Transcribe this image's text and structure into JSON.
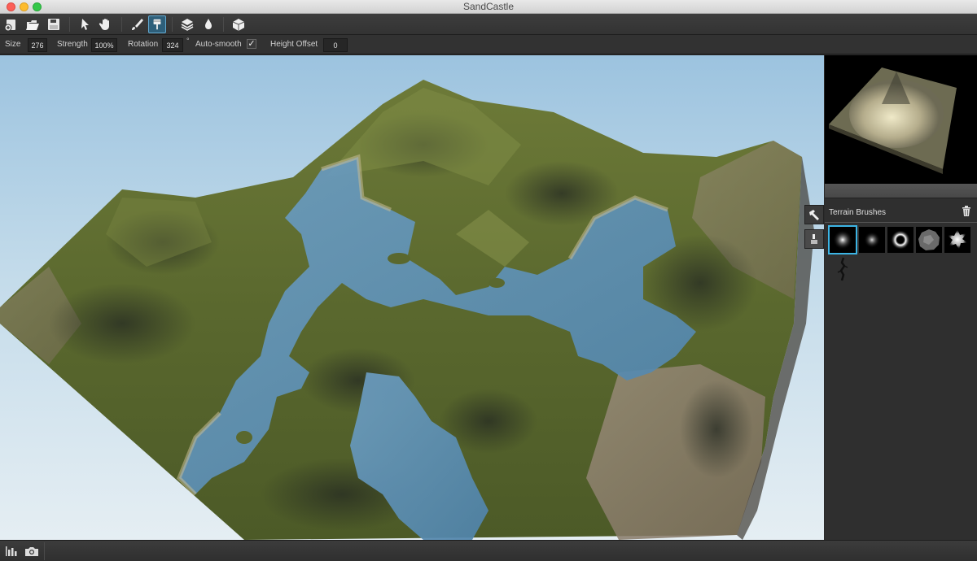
{
  "window": {
    "title": "SandCastle"
  },
  "toolbar": {
    "buttons": [
      {
        "name": "new-scene-icon",
        "tooltip": ""
      },
      {
        "name": "open-icon"
      },
      {
        "name": "save-icon"
      },
      {
        "name": "select-arrow-icon"
      },
      {
        "name": "pan-hand-icon"
      },
      {
        "name": "paintbrush-icon"
      },
      {
        "name": "terrain-brush-icon",
        "active": true
      },
      {
        "name": "layers-icon"
      },
      {
        "name": "water-drop-icon"
      },
      {
        "name": "export-object-icon"
      }
    ]
  },
  "options": {
    "size_label": "Size",
    "size_value": "276",
    "strength_label": "Strength",
    "strength_value": "100%",
    "rotation_label": "Rotation",
    "rotation_value": "324",
    "degree_symbol": "°",
    "autosmooth_label": "Auto-smooth",
    "autosmooth_checked": true,
    "height_offset_label": "Height Offset",
    "height_offset_value": "0"
  },
  "right_panel": {
    "brushes_title": "Terrain Brushes",
    "brushes": [
      {
        "name": "soft-round-brush",
        "selected": true
      },
      {
        "name": "soft-small-brush",
        "selected": false
      },
      {
        "name": "ring-crater-brush",
        "selected": false
      },
      {
        "name": "rough-rock-brush",
        "selected": false
      },
      {
        "name": "splatter-brush",
        "selected": false
      },
      {
        "name": "crack-brush",
        "selected": false
      }
    ],
    "side_tabs": [
      "hammer-tools-icon",
      "brush-pen-icon"
    ]
  },
  "bottom_bar": {
    "buttons": [
      "stats-bars-icon",
      "camera-icon"
    ]
  },
  "colors": {
    "selection_accent": "#3cb4e4",
    "terrain_grass": "#5f6b32",
    "terrain_rock": "#8a7a66",
    "water": "#5d8fb4",
    "sky": "#a8c9e2"
  }
}
